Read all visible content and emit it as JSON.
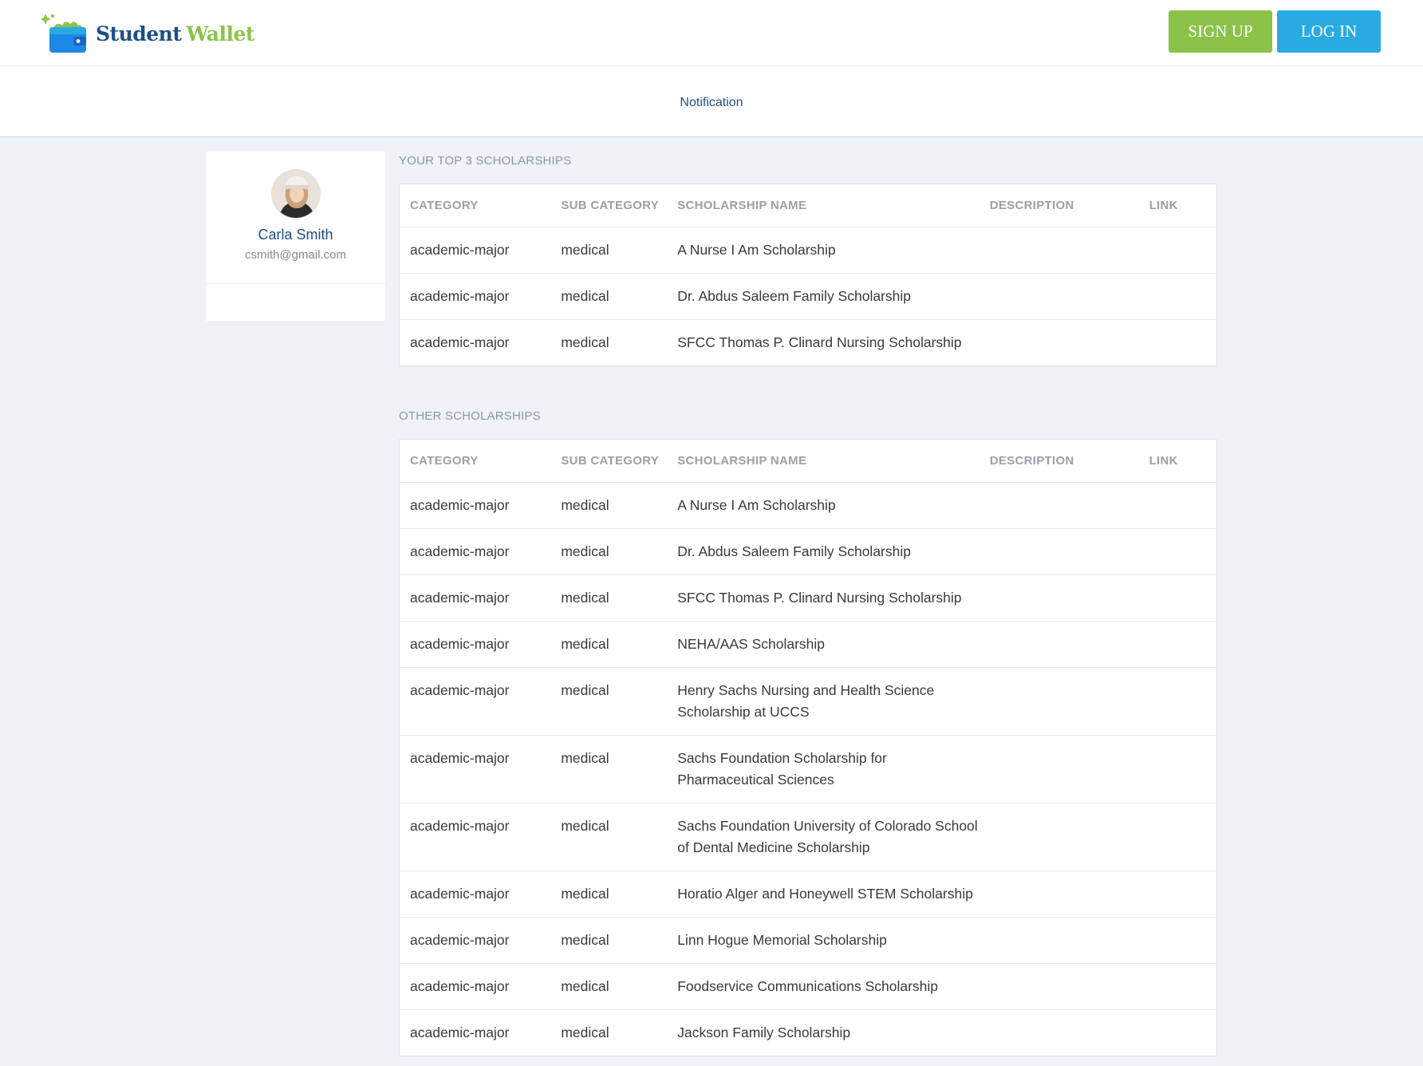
{
  "header": {
    "logo_word_1": "Student",
    "logo_word_2": "Wallet",
    "signup_label": "SIGN UP",
    "login_label": "LOG IN"
  },
  "subnav": {
    "notification_label": "Notification"
  },
  "profile": {
    "name": "Carla Smith",
    "email": "csmith@gmail.com"
  },
  "columns": [
    "CATEGORY",
    "SUB CATEGORY",
    "SCHOLARSHIP NAME",
    "DESCRIPTION",
    "LINK"
  ],
  "top_section": {
    "title": "YOUR TOP 3 SCHOLARSHIPS",
    "rows": [
      {
        "category": "academic-major",
        "sub_category": "medical",
        "name": "A Nurse I Am Scholarship",
        "description": "",
        "link": ""
      },
      {
        "category": "academic-major",
        "sub_category": "medical",
        "name": "Dr. Abdus Saleem Family Scholarship",
        "description": "",
        "link": ""
      },
      {
        "category": "academic-major",
        "sub_category": "medical",
        "name": "SFCC Thomas P. Clinard Nursing Scholarship",
        "description": "",
        "link": ""
      }
    ]
  },
  "other_section": {
    "title": "OTHER SCHOLARSHIPS",
    "rows": [
      {
        "category": "academic-major",
        "sub_category": "medical",
        "name": "A Nurse I Am Scholarship",
        "description": "",
        "link": ""
      },
      {
        "category": "academic-major",
        "sub_category": "medical",
        "name": "Dr. Abdus Saleem Family Scholarship",
        "description": "",
        "link": ""
      },
      {
        "category": "academic-major",
        "sub_category": "medical",
        "name": "SFCC Thomas P. Clinard Nursing Scholarship",
        "description": "",
        "link": ""
      },
      {
        "category": "academic-major",
        "sub_category": "medical",
        "name": "NEHA/AAS Scholarship",
        "description": "",
        "link": ""
      },
      {
        "category": "academic-major",
        "sub_category": "medical",
        "name": "Henry Sachs Nursing and Health Science Scholarship at UCCS",
        "description": "",
        "link": ""
      },
      {
        "category": "academic-major",
        "sub_category": "medical",
        "name": "Sachs Foundation Scholarship for Pharmaceutical Sciences",
        "description": "",
        "link": ""
      },
      {
        "category": "academic-major",
        "sub_category": "medical",
        "name": "Sachs Foundation University of Colorado School of Dental Medicine Scholarship",
        "description": "",
        "link": ""
      },
      {
        "category": "academic-major",
        "sub_category": "medical",
        "name": "Horatio Alger and Honeywell STEM Scholarship",
        "description": "",
        "link": ""
      },
      {
        "category": "academic-major",
        "sub_category": "medical",
        "name": "Linn Hogue Memorial Scholarship",
        "description": "",
        "link": ""
      },
      {
        "category": "academic-major",
        "sub_category": "medical",
        "name": "Foodservice Communications Scholarship",
        "description": "",
        "link": ""
      },
      {
        "category": "academic-major",
        "sub_category": "medical",
        "name": "Jackson Family Scholarship",
        "description": "",
        "link": ""
      }
    ]
  },
  "colors": {
    "brand_blue": "#1d4f86",
    "brand_green": "#8bc34a",
    "login_blue": "#29abe2",
    "page_bg": "#eef3f8"
  }
}
